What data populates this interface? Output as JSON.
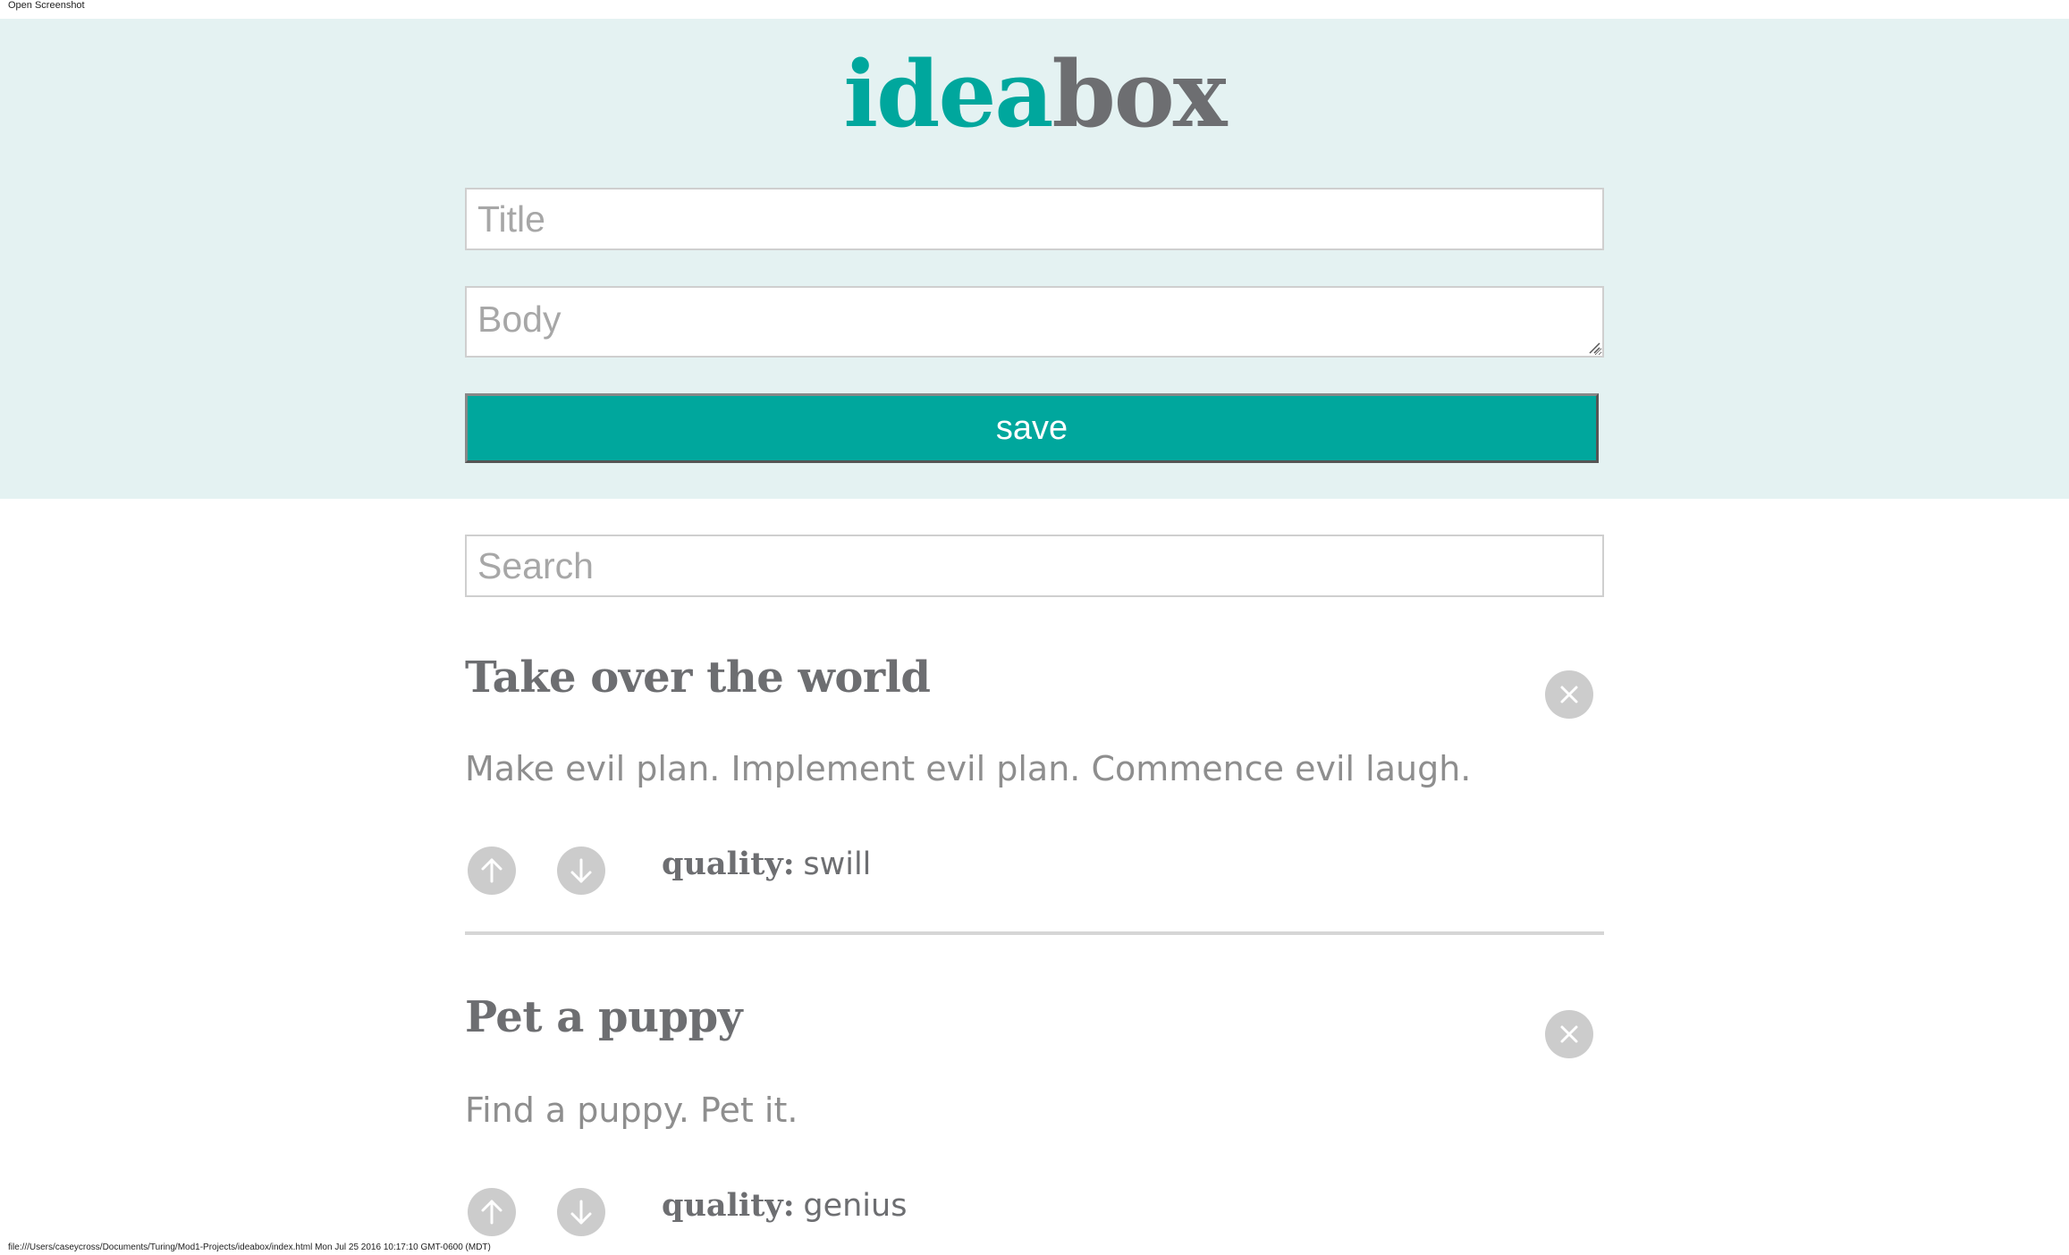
{
  "window": {
    "caption": "Open Screenshot",
    "status_bar": "file:///Users/caseycross/Documents/Turing/Mod1-Projects/ideabox/index.html Mon Jul 25 2016 10:17:10 GMT-0600 (MDT)"
  },
  "header": {
    "logo_part1": "idea",
    "logo_part2": "box",
    "logo_color_part1": "#00a79d",
    "logo_color_part2": "#6d6e71",
    "background": "#e4f2f2"
  },
  "form": {
    "title_placeholder": "Title",
    "title_value": "",
    "body_placeholder": "Body",
    "body_value": "",
    "save_label": "save",
    "save_color": "#00a79d"
  },
  "search": {
    "placeholder": "Search",
    "value": ""
  },
  "ideas": [
    {
      "title": "Take over the world",
      "body": "Make evil plan. Implement evil plan. Commence evil laugh.",
      "quality_label": "quality:",
      "quality_value": "swill",
      "icons": [
        "close-icon",
        "upvote-arrow-icon",
        "downvote-arrow-icon"
      ]
    },
    {
      "title": "Pet a puppy",
      "body": "Find a puppy. Pet it.",
      "quality_label": "quality:",
      "quality_value": "genius",
      "icons": [
        "close-icon",
        "upvote-arrow-icon",
        "downvote-arrow-icon"
      ]
    }
  ]
}
